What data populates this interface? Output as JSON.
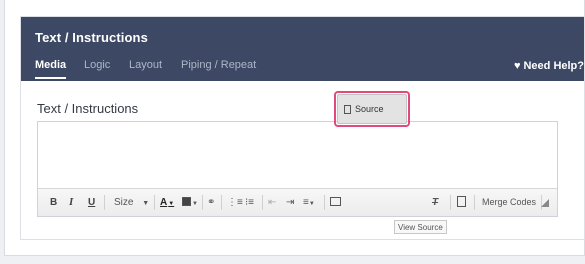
{
  "header": {
    "title": "Text / Instructions",
    "tabs": [
      {
        "label": "Media",
        "active": true
      },
      {
        "label": "Logic",
        "active": false
      },
      {
        "label": "Layout",
        "active": false
      },
      {
        "label": "Piping / Repeat",
        "active": false
      }
    ],
    "help_label": "Need Help?"
  },
  "field": {
    "label": "Text / Instructions",
    "value": ""
  },
  "toolbar": {
    "bold": "B",
    "italic": "I",
    "underline": "U",
    "size_label": "Size",
    "source_label": "Source",
    "merge_codes_label": "Merge Codes",
    "tooltip": "View Source"
  },
  "colors": {
    "header_bg": "#3d4864",
    "highlight": "#e24a7b"
  }
}
